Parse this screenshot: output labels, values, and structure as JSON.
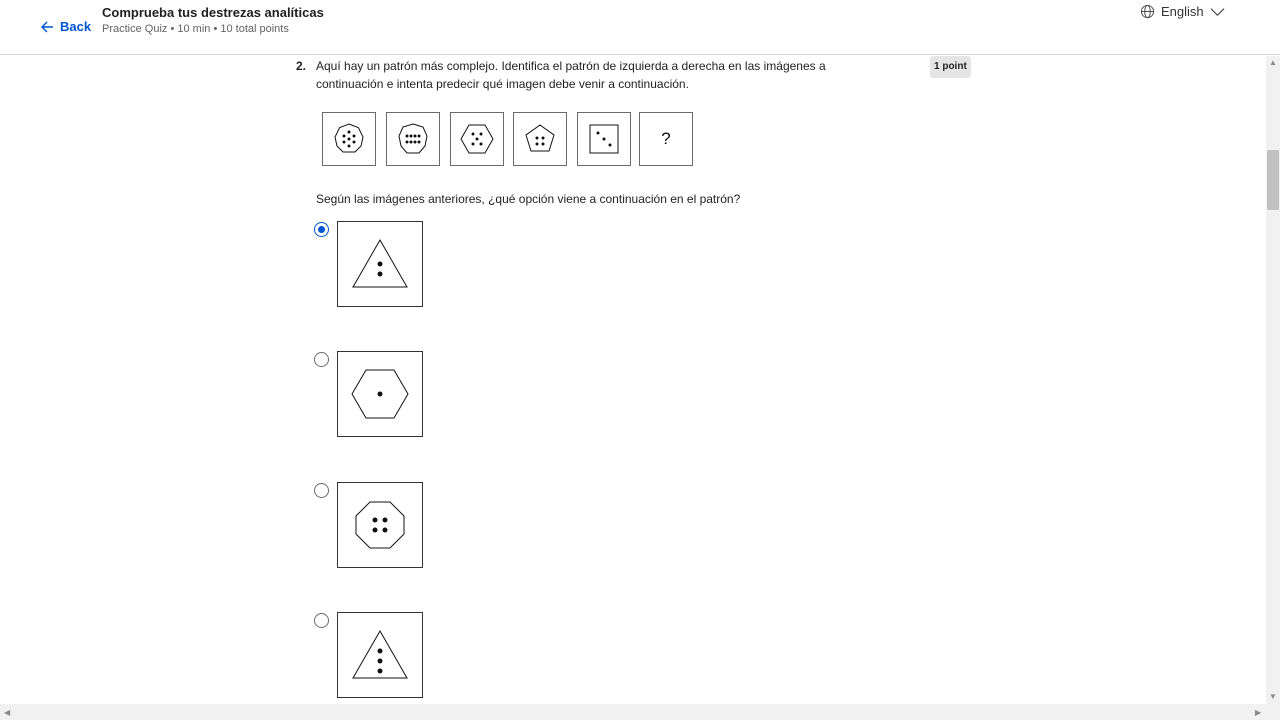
{
  "header": {
    "back_label": "Back",
    "quiz_title": "Comprueba tus destrezas analíticas",
    "quiz_meta": "Practice Quiz • 10 min • 10 total points",
    "language": "English"
  },
  "question": {
    "number": "2.",
    "text": "Aquí hay un patrón más complejo. Identifica el patrón de izquierda a derecha en las imágenes a continuación e intenta predecir qué imagen debe venir a continuación.",
    "points": "1 point",
    "sequence_placeholder": "?",
    "prompt": "Según las imágenes anteriores, ¿qué opción viene a continuación en el patrón?",
    "selected_option": 1
  },
  "icons": {
    "back": "arrow-left-icon",
    "language": "globe-icon",
    "dropdown": "chevron-down-icon"
  },
  "colors": {
    "accent": "#0056d2"
  }
}
